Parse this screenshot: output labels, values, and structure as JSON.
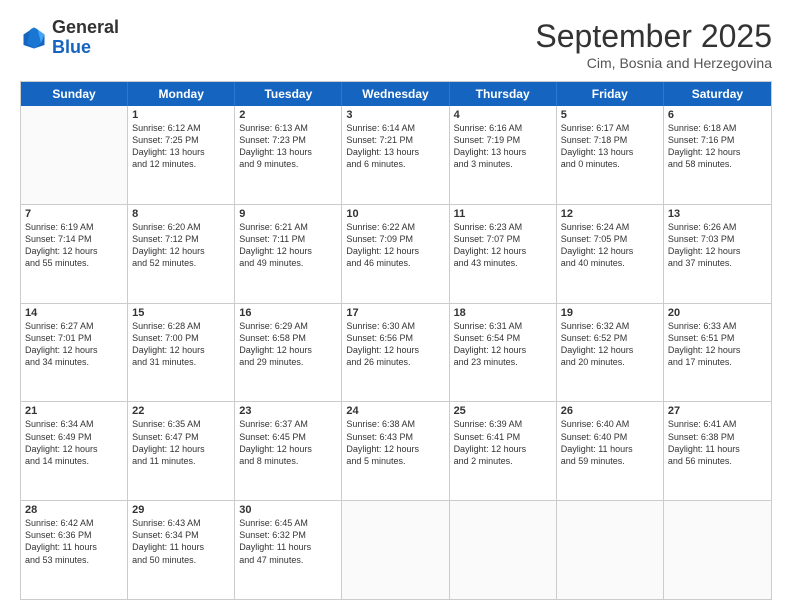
{
  "header": {
    "logo_general": "General",
    "logo_blue": "Blue",
    "month_title": "September 2025",
    "subtitle": "Cim, Bosnia and Herzegovina"
  },
  "days": [
    "Sunday",
    "Monday",
    "Tuesday",
    "Wednesday",
    "Thursday",
    "Friday",
    "Saturday"
  ],
  "rows": [
    [
      {
        "day": "",
        "lines": []
      },
      {
        "day": "1",
        "lines": [
          "Sunrise: 6:12 AM",
          "Sunset: 7:25 PM",
          "Daylight: 13 hours",
          "and 12 minutes."
        ]
      },
      {
        "day": "2",
        "lines": [
          "Sunrise: 6:13 AM",
          "Sunset: 7:23 PM",
          "Daylight: 13 hours",
          "and 9 minutes."
        ]
      },
      {
        "day": "3",
        "lines": [
          "Sunrise: 6:14 AM",
          "Sunset: 7:21 PM",
          "Daylight: 13 hours",
          "and 6 minutes."
        ]
      },
      {
        "day": "4",
        "lines": [
          "Sunrise: 6:16 AM",
          "Sunset: 7:19 PM",
          "Daylight: 13 hours",
          "and 3 minutes."
        ]
      },
      {
        "day": "5",
        "lines": [
          "Sunrise: 6:17 AM",
          "Sunset: 7:18 PM",
          "Daylight: 13 hours",
          "and 0 minutes."
        ]
      },
      {
        "day": "6",
        "lines": [
          "Sunrise: 6:18 AM",
          "Sunset: 7:16 PM",
          "Daylight: 12 hours",
          "and 58 minutes."
        ]
      }
    ],
    [
      {
        "day": "7",
        "lines": [
          "Sunrise: 6:19 AM",
          "Sunset: 7:14 PM",
          "Daylight: 12 hours",
          "and 55 minutes."
        ]
      },
      {
        "day": "8",
        "lines": [
          "Sunrise: 6:20 AM",
          "Sunset: 7:12 PM",
          "Daylight: 12 hours",
          "and 52 minutes."
        ]
      },
      {
        "day": "9",
        "lines": [
          "Sunrise: 6:21 AM",
          "Sunset: 7:11 PM",
          "Daylight: 12 hours",
          "and 49 minutes."
        ]
      },
      {
        "day": "10",
        "lines": [
          "Sunrise: 6:22 AM",
          "Sunset: 7:09 PM",
          "Daylight: 12 hours",
          "and 46 minutes."
        ]
      },
      {
        "day": "11",
        "lines": [
          "Sunrise: 6:23 AM",
          "Sunset: 7:07 PM",
          "Daylight: 12 hours",
          "and 43 minutes."
        ]
      },
      {
        "day": "12",
        "lines": [
          "Sunrise: 6:24 AM",
          "Sunset: 7:05 PM",
          "Daylight: 12 hours",
          "and 40 minutes."
        ]
      },
      {
        "day": "13",
        "lines": [
          "Sunrise: 6:26 AM",
          "Sunset: 7:03 PM",
          "Daylight: 12 hours",
          "and 37 minutes."
        ]
      }
    ],
    [
      {
        "day": "14",
        "lines": [
          "Sunrise: 6:27 AM",
          "Sunset: 7:01 PM",
          "Daylight: 12 hours",
          "and 34 minutes."
        ]
      },
      {
        "day": "15",
        "lines": [
          "Sunrise: 6:28 AM",
          "Sunset: 7:00 PM",
          "Daylight: 12 hours",
          "and 31 minutes."
        ]
      },
      {
        "day": "16",
        "lines": [
          "Sunrise: 6:29 AM",
          "Sunset: 6:58 PM",
          "Daylight: 12 hours",
          "and 29 minutes."
        ]
      },
      {
        "day": "17",
        "lines": [
          "Sunrise: 6:30 AM",
          "Sunset: 6:56 PM",
          "Daylight: 12 hours",
          "and 26 minutes."
        ]
      },
      {
        "day": "18",
        "lines": [
          "Sunrise: 6:31 AM",
          "Sunset: 6:54 PM",
          "Daylight: 12 hours",
          "and 23 minutes."
        ]
      },
      {
        "day": "19",
        "lines": [
          "Sunrise: 6:32 AM",
          "Sunset: 6:52 PM",
          "Daylight: 12 hours",
          "and 20 minutes."
        ]
      },
      {
        "day": "20",
        "lines": [
          "Sunrise: 6:33 AM",
          "Sunset: 6:51 PM",
          "Daylight: 12 hours",
          "and 17 minutes."
        ]
      }
    ],
    [
      {
        "day": "21",
        "lines": [
          "Sunrise: 6:34 AM",
          "Sunset: 6:49 PM",
          "Daylight: 12 hours",
          "and 14 minutes."
        ]
      },
      {
        "day": "22",
        "lines": [
          "Sunrise: 6:35 AM",
          "Sunset: 6:47 PM",
          "Daylight: 12 hours",
          "and 11 minutes."
        ]
      },
      {
        "day": "23",
        "lines": [
          "Sunrise: 6:37 AM",
          "Sunset: 6:45 PM",
          "Daylight: 12 hours",
          "and 8 minutes."
        ]
      },
      {
        "day": "24",
        "lines": [
          "Sunrise: 6:38 AM",
          "Sunset: 6:43 PM",
          "Daylight: 12 hours",
          "and 5 minutes."
        ]
      },
      {
        "day": "25",
        "lines": [
          "Sunrise: 6:39 AM",
          "Sunset: 6:41 PM",
          "Daylight: 12 hours",
          "and 2 minutes."
        ]
      },
      {
        "day": "26",
        "lines": [
          "Sunrise: 6:40 AM",
          "Sunset: 6:40 PM",
          "Daylight: 11 hours",
          "and 59 minutes."
        ]
      },
      {
        "day": "27",
        "lines": [
          "Sunrise: 6:41 AM",
          "Sunset: 6:38 PM",
          "Daylight: 11 hours",
          "and 56 minutes."
        ]
      }
    ],
    [
      {
        "day": "28",
        "lines": [
          "Sunrise: 6:42 AM",
          "Sunset: 6:36 PM",
          "Daylight: 11 hours",
          "and 53 minutes."
        ]
      },
      {
        "day": "29",
        "lines": [
          "Sunrise: 6:43 AM",
          "Sunset: 6:34 PM",
          "Daylight: 11 hours",
          "and 50 minutes."
        ]
      },
      {
        "day": "30",
        "lines": [
          "Sunrise: 6:45 AM",
          "Sunset: 6:32 PM",
          "Daylight: 11 hours",
          "and 47 minutes."
        ]
      },
      {
        "day": "",
        "lines": []
      },
      {
        "day": "",
        "lines": []
      },
      {
        "day": "",
        "lines": []
      },
      {
        "day": "",
        "lines": []
      }
    ]
  ]
}
